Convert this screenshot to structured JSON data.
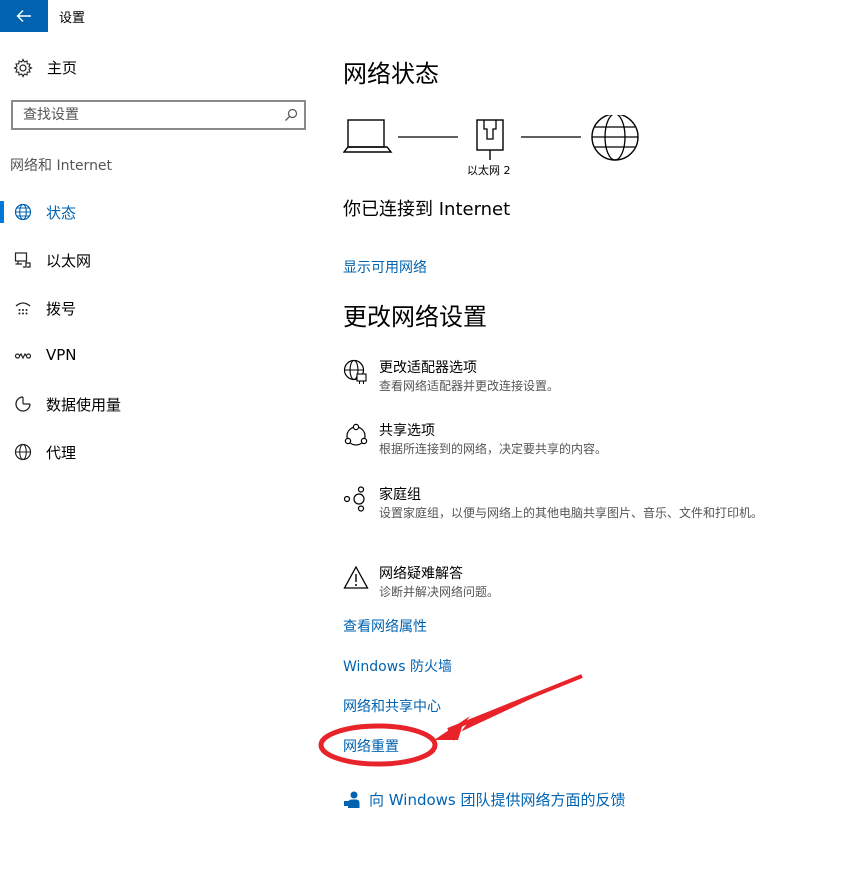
{
  "window": {
    "title": "设置"
  },
  "sidebar": {
    "home_label": "主页",
    "search_placeholder": "查找设置",
    "section_label": "网络和 Internet",
    "items": [
      {
        "label": "状态",
        "icon": "globe-icon",
        "active": true
      },
      {
        "label": "以太网",
        "icon": "ethernet-icon",
        "active": false
      },
      {
        "label": "拨号",
        "icon": "dialup-icon",
        "active": false
      },
      {
        "label": "VPN",
        "icon": "vpn-icon",
        "active": false
      },
      {
        "label": "数据使用量",
        "icon": "data-usage-icon",
        "active": false
      },
      {
        "label": "代理",
        "icon": "globe-icon",
        "active": false
      }
    ]
  },
  "main": {
    "status_title": "网络状态",
    "diagram_label": "以太网 2",
    "connected_text": "你已连接到 Internet",
    "show_networks_link": "显示可用网络",
    "change_title": "更改网络设置",
    "options": [
      {
        "title": "更改适配器选项",
        "desc": "查看网络适配器并更改连接设置。",
        "icon": "adapter-icon"
      },
      {
        "title": "共享选项",
        "desc": "根据所连接到的网络，决定要共享的内容。",
        "icon": "sharing-icon"
      },
      {
        "title": "家庭组",
        "desc": "设置家庭组，以便与网络上的其他电脑共享图片、音乐、文件和打印机。",
        "icon": "homegroup-icon"
      },
      {
        "title": "网络疑难解答",
        "desc": "诊断并解决网络问题。",
        "icon": "warning-icon"
      }
    ],
    "links": {
      "properties": "查看网络属性",
      "firewall": "Windows 防火墙",
      "sharing_center": "网络和共享中心",
      "reset": "网络重置"
    },
    "feedback_link": "向 Windows 团队提供网络方面的反馈"
  },
  "colors": {
    "accent": "#0063b1",
    "annotation": "#e8232a"
  }
}
